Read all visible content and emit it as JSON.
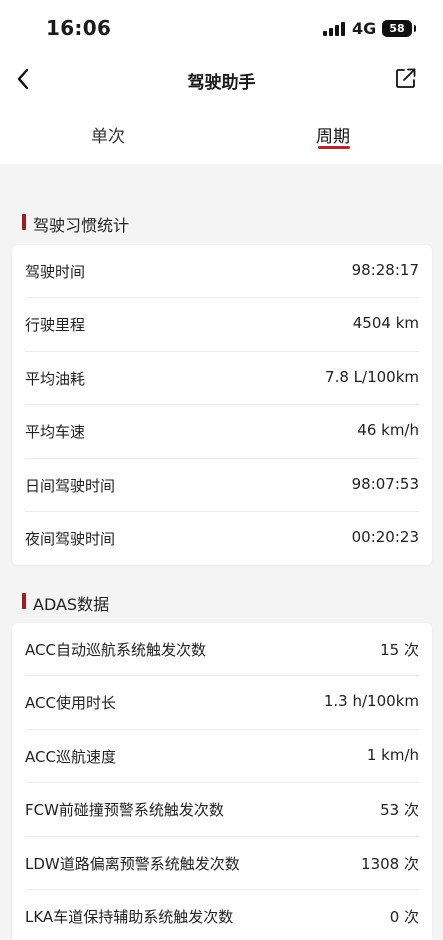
{
  "status_bar": {
    "time": "16:06",
    "network": "4G",
    "battery": "58"
  },
  "nav": {
    "title": "驾驶助手"
  },
  "tabs": [
    {
      "label": "单次",
      "selected": false
    },
    {
      "label": "周期",
      "selected": true
    }
  ],
  "habit_section": {
    "title": "驾驶习惯统计",
    "rows": [
      {
        "label": "驾驶时间",
        "value": "98:28:17"
      },
      {
        "label": "行驶里程",
        "value": "4504 km"
      },
      {
        "label": "平均油耗",
        "value": "7.8 L/100km"
      },
      {
        "label": "平均车速",
        "value": "46 km/h"
      },
      {
        "label": "日间驾驶时间",
        "value": "98:07:53"
      },
      {
        "label": "夜间驾驶时间",
        "value": "00:20:23"
      }
    ]
  },
  "adas_section": {
    "title": "ADAS数据",
    "rows": [
      {
        "label": "ACC自动巡航系统触发次数",
        "value": "15 次"
      },
      {
        "label": "ACC使用时长",
        "value": "1.3 h/100km"
      },
      {
        "label": "ACC巡航速度",
        "value": "1 km/h"
      },
      {
        "label": "FCW前碰撞预警系统触发次数",
        "value": "53 次"
      },
      {
        "label": "LDW道路偏离预警系统触发次数",
        "value": "1308 次"
      },
      {
        "label": "LKA车道保持辅助系统触发次数",
        "value": "0 次"
      }
    ]
  },
  "colors": {
    "accent": "#b8262d",
    "section_marker": "#9b1c22",
    "background": "#f4f4f4"
  }
}
